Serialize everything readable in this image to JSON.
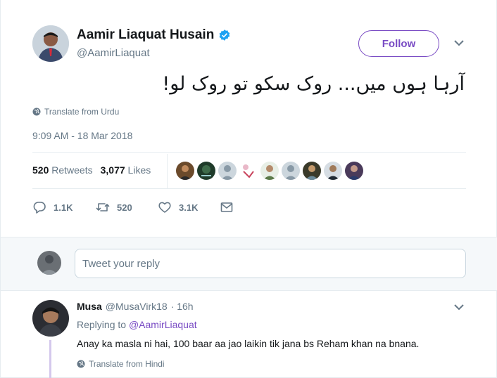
{
  "author": {
    "name": "Aamir Liaquat Husain",
    "handle": "@AamirLiaquat",
    "verified": true
  },
  "follow_label": "Follow",
  "tweet": {
    "text": "آرہا ہوں میں... روک سکو تو روک لو!",
    "translate_label": "Translate from Urdu",
    "timestamp": "9:09 AM - 18 Mar 2018"
  },
  "stats": {
    "retweets_count": "520",
    "retweets_label": "Retweets",
    "likes_count": "3,077",
    "likes_label": "Likes"
  },
  "actions": {
    "replies": "1.1K",
    "retweets": "520",
    "likes": "3.1K"
  },
  "composer": {
    "placeholder": "Tweet your reply"
  },
  "reply": {
    "name": "Musa",
    "handle": "@MusaVirk18",
    "time": "· 16h",
    "replying_prefix": "Replying to",
    "replying_to": "@AamirLiaquat",
    "text": "Anay ka masla ni hai, 100 baar aa jao laikin tik jana bs Reham khan na bnana.",
    "translate_label": "Translate from Hindi"
  },
  "colors": {
    "accent": "#794bc4",
    "muted": "#657786",
    "verified": "#1da1f2"
  }
}
